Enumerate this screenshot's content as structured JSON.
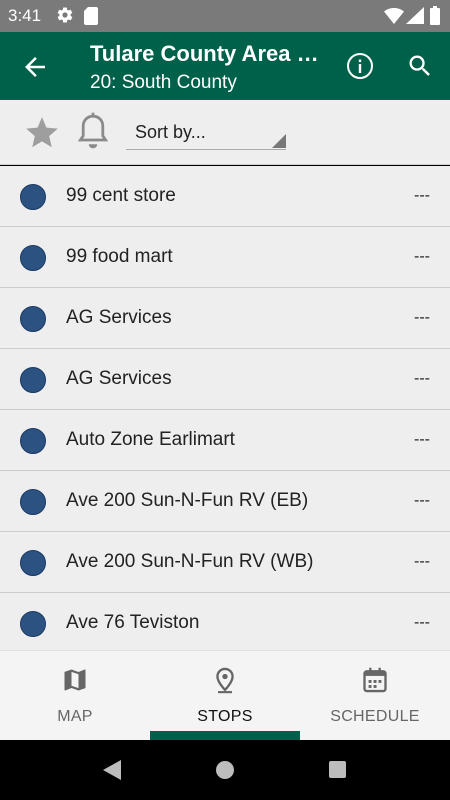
{
  "status_bar": {
    "time": "3:41",
    "icons": [
      "gear-icon",
      "sd-card-icon",
      "wifi-icon",
      "signal-icon",
      "battery-icon"
    ]
  },
  "app_bar": {
    "title": "Tulare County Area Transit",
    "subtitle": "20: South County",
    "background_color": "#00614a",
    "icons": [
      "back-arrow-icon",
      "info-icon",
      "search-icon"
    ]
  },
  "filter_bar": {
    "sort_label": "Sort by...",
    "icons": [
      "star-icon",
      "bell-icon"
    ]
  },
  "stops": [
    {
      "name": "99 cent store",
      "time": "---"
    },
    {
      "name": "99 food mart",
      "time": "---"
    },
    {
      "name": "AG Services",
      "time": "---"
    },
    {
      "name": "AG Services",
      "time": "---"
    },
    {
      "name": "Auto Zone Earlimart",
      "time": "---"
    },
    {
      "name": "Ave 200 Sun-N-Fun RV (EB)",
      "time": "---"
    },
    {
      "name": "Ave 200 Sun-N-Fun RV (WB)",
      "time": "---"
    },
    {
      "name": "Ave 76 Teviston",
      "time": "---"
    }
  ],
  "stop_dot_color": "#2c5282",
  "bottom_nav": {
    "tabs": [
      {
        "label": "MAP",
        "icon": "map-icon"
      },
      {
        "label": "STOPS",
        "icon": "location-pin-icon"
      },
      {
        "label": "SCHEDULE",
        "icon": "calendar-icon"
      }
    ],
    "active_tab": "STOPS"
  },
  "system_nav": {
    "icons": [
      "back-triangle-icon",
      "home-circle-icon",
      "recents-square-icon"
    ]
  }
}
